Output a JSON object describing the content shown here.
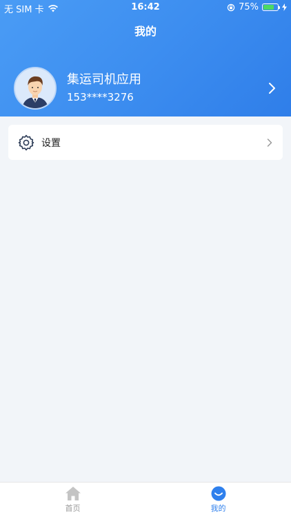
{
  "status_bar": {
    "carrier": "无 SIM 卡",
    "time": "16:42",
    "battery_percent": "75%",
    "battery_level": 0.75
  },
  "nav": {
    "title": "我的"
  },
  "profile": {
    "name": "集运司机应用",
    "phone": "153****3276"
  },
  "menu": {
    "settings_label": "设置"
  },
  "tabbar": {
    "tabs": [
      {
        "label": "首页",
        "icon": "home-icon",
        "active": false
      },
      {
        "label": "我的",
        "icon": "smile-icon",
        "active": true
      }
    ]
  },
  "colors": {
    "header_start": "#4a9cf5",
    "header_end": "#2f7ee9",
    "accent": "#2f80ed",
    "background": "#f2f5f9"
  }
}
